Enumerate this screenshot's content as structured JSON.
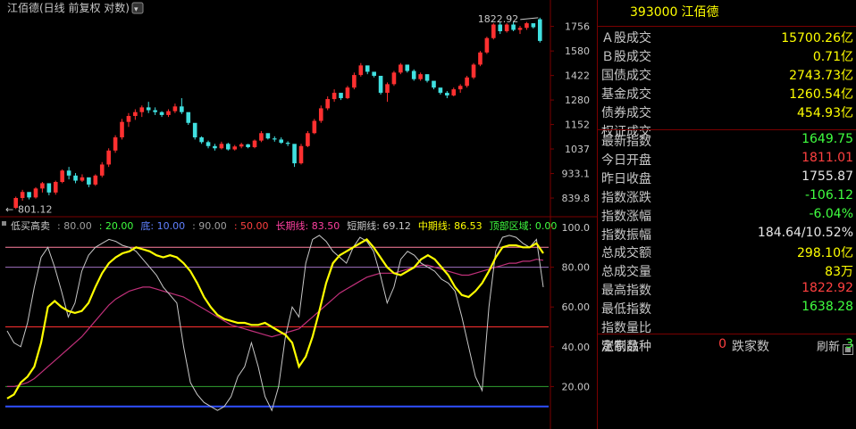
{
  "chart_title": "江佰德(日线 前复权 对数)",
  "price_axis_ticks": [
    "1756",
    "1580",
    "1422",
    "1280",
    "1152",
    "1037",
    "933.1",
    "839.8"
  ],
  "high_label": "1822.92",
  "low_label": "801.12",
  "indicator_header": [
    {
      "text": "低买高卖",
      "color": "#c8c8c8"
    },
    {
      "text": ": 80.00",
      "color": "#a0a0a0"
    },
    {
      "text": ": 20.00",
      "color": "#40ff40"
    },
    {
      "text": "底: 10.00",
      "color": "#6080ff"
    },
    {
      "text": ": 90.00",
      "color": "#a0a0a0"
    },
    {
      "text": ": 50.00",
      "color": "#ff4040"
    },
    {
      "text": "长期线: 83.50",
      "color": "#ff40a0"
    },
    {
      "text": "短期线: 69.12",
      "color": "#c8c8c8"
    },
    {
      "text": "中期线: 86.53",
      "color": "#ffff00"
    },
    {
      "text": "顶部区域: 0.00",
      "color": "#40ff40"
    }
  ],
  "indicator_axis_ticks": [
    "100.0",
    "80.00",
    "60.00",
    "40.00",
    "20.00"
  ],
  "colors": {
    "up": "#ff3030",
    "down": "#40e0e0",
    "yellow": "#ffff00",
    "magenta": "#c0307a",
    "grid": "#7a0000"
  },
  "chart_data": [
    {
      "type": "candlestick",
      "title": "江佰德(日线 前复权 对数)",
      "scale": "log",
      "ylim": [
        790,
        1850
      ],
      "candles": [
        [
          805,
          845,
          801,
          840
        ],
        [
          840,
          870,
          830,
          862
        ],
        [
          862,
          855,
          835,
          842
        ],
        [
          842,
          880,
          838,
          875
        ],
        [
          875,
          900,
          860,
          895
        ],
        [
          895,
          880,
          850,
          860
        ],
        [
          860,
          905,
          852,
          900
        ],
        [
          900,
          950,
          895,
          945
        ],
        [
          945,
          960,
          910,
          925
        ],
        [
          925,
          935,
          895,
          905
        ],
        [
          905,
          930,
          900,
          918
        ],
        [
          918,
          905,
          880,
          890
        ],
        [
          890,
          930,
          885,
          925
        ],
        [
          925,
          980,
          918,
          970
        ],
        [
          970,
          1040,
          960,
          1030
        ],
        [
          1030,
          1100,
          1020,
          1090
        ],
        [
          1090,
          1180,
          1080,
          1165
        ],
        [
          1165,
          1210,
          1140,
          1195
        ],
        [
          1195,
          1230,
          1175,
          1215
        ],
        [
          1215,
          1250,
          1190,
          1240
        ],
        [
          1240,
          1270,
          1210,
          1225
        ],
        [
          1225,
          1240,
          1200,
          1215
        ],
        [
          1215,
          1220,
          1190,
          1200
        ],
        [
          1200,
          1230,
          1190,
          1220
        ],
        [
          1220,
          1260,
          1210,
          1245
        ],
        [
          1245,
          1290,
          1205,
          1215
        ],
        [
          1215,
          1200,
          1150,
          1160
        ],
        [
          1160,
          1140,
          1080,
          1090
        ],
        [
          1090,
          1095,
          1060,
          1068
        ],
        [
          1068,
          1075,
          1040,
          1050
        ],
        [
          1050,
          1060,
          1030,
          1040
        ],
        [
          1040,
          1070,
          1035,
          1060
        ],
        [
          1060,
          1065,
          1030,
          1035
        ],
        [
          1035,
          1055,
          1030,
          1048
        ],
        [
          1048,
          1065,
          1040,
          1058
        ],
        [
          1058,
          1060,
          1040,
          1045
        ],
        [
          1045,
          1080,
          1040,
          1075
        ],
        [
          1075,
          1120,
          1068,
          1110
        ],
        [
          1110,
          1100,
          1080,
          1085
        ],
        [
          1085,
          1095,
          1070,
          1080
        ],
        [
          1080,
          1090,
          1060,
          1065
        ],
        [
          1065,
          1072,
          1050,
          1060
        ],
        [
          1060,
          1030,
          960,
          975
        ],
        [
          975,
          1060,
          970,
          1050
        ],
        [
          1050,
          1120,
          1045,
          1110
        ],
        [
          1110,
          1180,
          1105,
          1170
        ],
        [
          1170,
          1250,
          1160,
          1235
        ],
        [
          1235,
          1300,
          1225,
          1285
        ],
        [
          1285,
          1340,
          1270,
          1320
        ],
        [
          1320,
          1310,
          1280,
          1290
        ],
        [
          1290,
          1360,
          1285,
          1350
        ],
        [
          1350,
          1440,
          1340,
          1425
        ],
        [
          1425,
          1500,
          1415,
          1485
        ],
        [
          1485,
          1470,
          1430,
          1445
        ],
        [
          1445,
          1440,
          1410,
          1420
        ],
        [
          1420,
          1400,
          1310,
          1320
        ],
        [
          1320,
          1380,
          1270,
          1370
        ],
        [
          1370,
          1450,
          1360,
          1440
        ],
        [
          1440,
          1500,
          1430,
          1490
        ],
        [
          1490,
          1480,
          1440,
          1450
        ],
        [
          1450,
          1460,
          1390,
          1400
        ],
        [
          1400,
          1440,
          1390,
          1430
        ],
        [
          1430,
          1420,
          1380,
          1390
        ],
        [
          1390,
          1370,
          1340,
          1350
        ],
        [
          1350,
          1340,
          1310,
          1320
        ],
        [
          1320,
          1330,
          1290,
          1305
        ],
        [
          1305,
          1350,
          1300,
          1340
        ],
        [
          1340,
          1370,
          1320,
          1360
        ],
        [
          1360,
          1420,
          1350,
          1410
        ],
        [
          1410,
          1500,
          1400,
          1490
        ],
        [
          1490,
          1580,
          1480,
          1570
        ],
        [
          1570,
          1680,
          1560,
          1670
        ],
        [
          1670,
          1780,
          1660,
          1770
        ],
        [
          1770,
          1790,
          1700,
          1720
        ],
        [
          1720,
          1780,
          1710,
          1770
        ],
        [
          1770,
          1790,
          1720,
          1730
        ],
        [
          1730,
          1760,
          1700,
          1745
        ],
        [
          1745,
          1790,
          1730,
          1780
        ],
        [
          1780,
          1770,
          1740,
          1750
        ],
        [
          1811,
          1822.92,
          1638.28,
          1649.75
        ]
      ]
    },
    {
      "type": "line",
      "title": "低买高卖",
      "ylim": [
        0,
        100
      ],
      "reference_lines": [
        {
          "name": "底",
          "value": 10,
          "color": "#3050ff"
        },
        {
          "value": 20,
          "color": "#30a030"
        },
        {
          "value": 50,
          "color": "#ff3030"
        },
        {
          "value": 80,
          "color": "#a070c0"
        },
        {
          "value": 90,
          "color": "#ff80a0"
        }
      ],
      "series": [
        {
          "name": "中期线",
          "color": "#ffff00",
          "values": [
            14,
            16,
            22,
            25,
            30,
            42,
            60,
            63,
            60,
            58,
            57,
            58,
            62,
            70,
            77,
            82,
            85,
            87,
            88,
            90,
            89,
            88,
            86,
            85,
            86,
            85,
            82,
            78,
            72,
            65,
            60,
            56,
            54,
            53,
            52,
            52,
            51,
            51,
            52,
            50,
            48,
            46,
            42,
            30,
            35,
            45,
            58,
            72,
            82,
            86,
            88,
            90,
            92,
            94,
            90,
            85,
            80,
            77,
            76,
            78,
            80,
            84,
            86,
            84,
            80,
            76,
            70,
            66,
            65,
            68,
            72,
            78,
            85,
            90,
            91,
            91,
            90,
            90,
            92,
            87
          ]
        },
        {
          "name": "短期线",
          "color": "#c8c8c8",
          "values": [
            48,
            42,
            40,
            52,
            70,
            85,
            90,
            80,
            68,
            55,
            62,
            78,
            86,
            90,
            92,
            94,
            93,
            91,
            90,
            88,
            84,
            80,
            76,
            70,
            66,
            62,
            40,
            22,
            16,
            12,
            10,
            8,
            10,
            15,
            25,
            30,
            42,
            30,
            15,
            8,
            20,
            45,
            60,
            55,
            82,
            94,
            96,
            93,
            88,
            85,
            82,
            90,
            95,
            93,
            88,
            76,
            62,
            70,
            84,
            88,
            86,
            82,
            80,
            78,
            74,
            72,
            68,
            55,
            40,
            25,
            18,
            60,
            88,
            95,
            96,
            95,
            92,
            90,
            94,
            70
          ]
        },
        {
          "name": "长期线",
          "color": "#c0307a",
          "values": [
            20,
            20,
            21,
            22,
            24,
            27,
            30,
            33,
            36,
            39,
            42,
            45,
            49,
            53,
            57,
            61,
            64,
            66,
            68,
            69,
            70,
            70,
            69,
            68,
            67,
            66,
            65,
            63,
            61,
            59,
            57,
            55,
            53,
            51,
            50,
            49,
            48,
            47,
            46,
            45,
            46,
            47,
            48,
            49,
            52,
            55,
            58,
            61,
            64,
            67,
            69,
            71,
            73,
            75,
            76,
            77,
            77,
            77,
            78,
            79,
            80,
            81,
            81,
            80,
            79,
            78,
            77,
            76,
            76,
            77,
            78,
            79,
            80,
            81,
            82,
            82,
            83,
            83,
            84,
            83.5
          ]
        }
      ]
    }
  ],
  "info": {
    "code": "393000",
    "name": "江佰德",
    "rows_a": [
      {
        "label": "Ａ股成交",
        "value": "15700.26亿",
        "color": "yellow"
      },
      {
        "label": "Ｂ股成交",
        "value": "0.71亿",
        "color": "yellow"
      },
      {
        "label": "国债成交",
        "value": "2743.73亿",
        "color": "yellow"
      },
      {
        "label": "基金成交",
        "value": "1260.54亿",
        "color": "yellow"
      },
      {
        "label": "债券成交",
        "value": "454.93亿",
        "color": "yellow"
      },
      {
        "label": "权证成交",
        "value": "",
        "color": "yellow"
      }
    ],
    "rows_b": [
      {
        "label": "最新指数",
        "value": "1649.75",
        "color": "green"
      },
      {
        "label": "今日开盘",
        "value": "1811.01",
        "color": "red"
      },
      {
        "label": "昨日收盘",
        "value": "1755.87",
        "color": "white"
      },
      {
        "label": "指数涨跌",
        "value": "-106.12",
        "color": "green"
      },
      {
        "label": "指数涨幅",
        "value": "-6.04%",
        "color": "green"
      },
      {
        "label": "指数振幅",
        "value": "184.64/10.52%",
        "color": "white"
      },
      {
        "label": "总成交额",
        "value": "298.10亿",
        "color": "yellow"
      },
      {
        "label": "总成交量",
        "value": "83万",
        "color": "yellow"
      },
      {
        "label": "最高指数",
        "value": "1822.92",
        "color": "red"
      },
      {
        "label": "最低指数",
        "value": "1638.28",
        "color": "green"
      },
      {
        "label": "指数量比",
        "value": "",
        "color": "white"
      },
      {
        "label": "定制品种",
        "value": "",
        "color": "white"
      }
    ],
    "refresh_label": "刷新",
    "up_count_label": "涨家数",
    "up_count": "0",
    "down_count_label": "跌家数",
    "down_count": "3"
  }
}
